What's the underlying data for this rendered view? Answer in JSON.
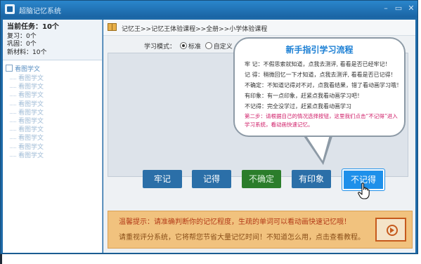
{
  "window": {
    "title": "超脑记忆系统",
    "min_glyph": "–",
    "restore_glyph": "▭",
    "close_glyph": "✕"
  },
  "stats": {
    "current_task": "当前任务：10个",
    "review": "复习：0个",
    "consolidate": "巩固：0个",
    "new_material": "新材料：10个"
  },
  "tree": {
    "root": "看图学文",
    "items": [
      "看图学文",
      "看图学文",
      "看图学文",
      "看图学文",
      "看图学文",
      "看图学文",
      "看图学文",
      "看图学文",
      "看图学文",
      "看图学文"
    ]
  },
  "breadcrumb": "记忆王>>记忆王体验课程>>全册>>小学体验课程",
  "mode": {
    "label": "学习模式：",
    "standard": "标准",
    "custom": "自定义",
    "selected": "standard"
  },
  "buttons": {
    "remember": "牢记",
    "know": "记得",
    "unsure": "不确定",
    "impression": "有印象",
    "forgot": "不记得"
  },
  "guide": {
    "title": "新手指引学习流程",
    "lines": [
      "牢  记：不假思索就知道，点我去测评, 看看是否已经牢记！",
      "记  得：稍微回忆一下才知道，点我去测评, 看看是否已记得！",
      "不确定：不知道记得对不对，点我看结果，错了看动画学习哦！",
      "有印象：有一点印象，赶紧点我看动画学习吧！",
      "不记得：完全没学过，赶紧点我看动画学习"
    ],
    "step2": "第二步：请根据自己的情况选择按钮，这里我们点击“不记得”进入学习系统，看动画快速记忆。"
  },
  "tip": {
    "line1": "温馨提示：请准确判断你的记忆程度，生疏的单词可以看动画快速记忆哦！",
    "line2": "请重视评分系统，它将帮您节省大量记忆时间！不知道怎么用，点击查看教程。"
  },
  "colors": {
    "accent": "#1e90ea",
    "window": "#1e6aa8",
    "warning": "#d0206a"
  }
}
